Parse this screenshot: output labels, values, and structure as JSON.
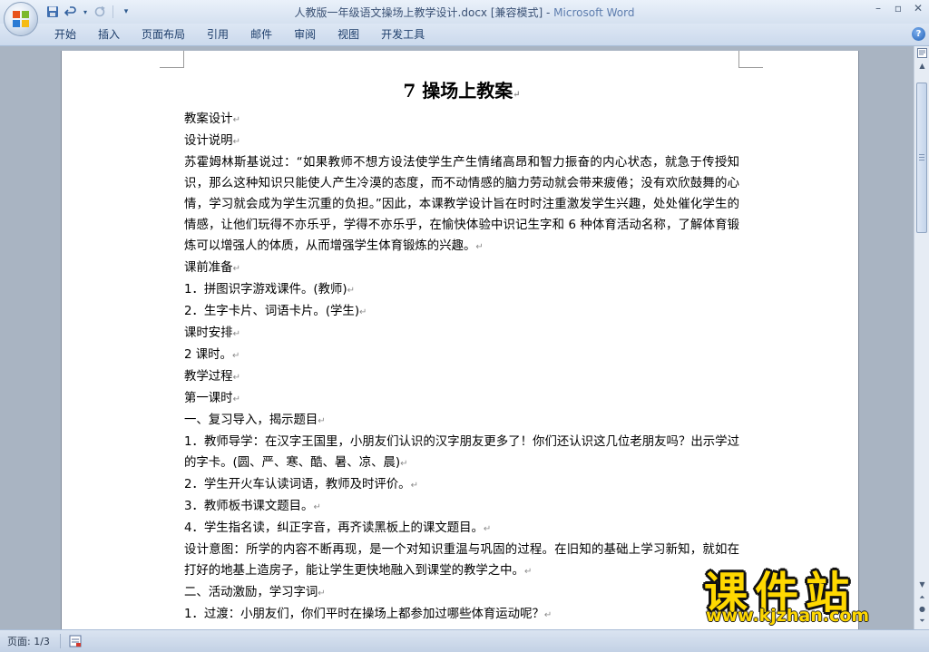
{
  "window": {
    "title": "人教版一年级语文操场上教学设计.docx [兼容模式]",
    "app_name": "Microsoft Word",
    "separator": " - "
  },
  "quick_access": {
    "icons": [
      "save-icon",
      "undo-icon",
      "redo-icon",
      "customize-icon"
    ]
  },
  "ribbon": {
    "tabs": [
      "开始",
      "插入",
      "页面布局",
      "引用",
      "邮件",
      "审阅",
      "视图",
      "开发工具"
    ]
  },
  "document": {
    "heading": "7  操场上教案",
    "paragraphs": [
      "教案设计",
      "设计说明",
      "苏霍姆林斯基说过：“如果教师不想方设法使学生产生情绪高昂和智力振奋的内心状态，就急于传授知识，那么这种知识只能使人产生冷漠的态度，而不动情感的脑力劳动就会带来疲倦；没有欢欣鼓舞的心情，学习就会成为学生沉重的负担。”因此，本课教学设计旨在时时注重激发学生兴趣，处处催化学生的情感，让他们玩得不亦乐乎，学得不亦乐乎，在愉快体验中识记生字和 6 种体育活动名称，了解体育锻炼可以增强人的体质，从而增强学生体育锻炼的兴趣。",
      "课前准备",
      "1．拼图识字游戏课件。(教师)",
      "2．生字卡片、词语卡片。(学生)",
      "课时安排",
      "2 课时。",
      "教学过程",
      "第一课时",
      "一、复习导入，揭示题目",
      "1．教师导学：在汉字王国里，小朋友们认识的汉字朋友更多了！你们还认识这几位老朋友吗？出示学过的字卡。(圆、严、寒、酷、暑、凉、晨)",
      "2．学生开火车认读词语，教师及时评价。",
      "3．教师板书课文题目。",
      "4．学生指名读，纠正字音，再齐读黑板上的课文题目。",
      "设计意图：所学的内容不断再现，是一个对知识重温与巩固的过程。在旧知的基础上学习新知，就如在打好的地基上造房子，能让学生更快地融入到课堂的教学之中。",
      "二、活动激励，学习字词",
      "1．过渡：小朋友们，你们平时在操场上都参加过哪些体育运动呢？"
    ],
    "paragraph_mark": "↵"
  },
  "status_bar": {
    "page_info": "页面: 1/3"
  },
  "watermark": {
    "text": "课件站",
    "url": "www.kjzhan.com"
  },
  "colors": {
    "ribbon_bg": "#cbd9ec",
    "workspace_bg": "#a9b4c2",
    "watermark_yellow": "#ffd800"
  }
}
